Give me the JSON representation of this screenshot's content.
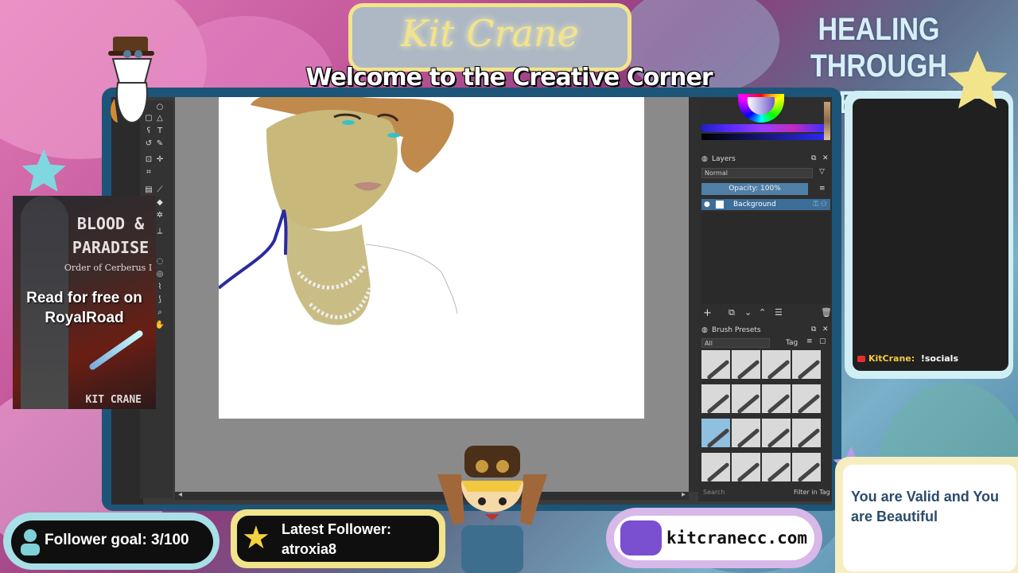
{
  "overlay": {
    "streamer_name": "Kit Crane",
    "welcome": "Welcome to the Creative Corner",
    "tagline": "HEALING THROUGH CREATIVITY"
  },
  "book": {
    "title": "BLOOD & PARADISE",
    "subtitle": "Order of Cerberus I",
    "cta": "Read for free on RoyalRoad",
    "author": "KIT CRANE"
  },
  "krita": {
    "layers_title": "Layers",
    "blend_mode": "Normal",
    "opacity_label": "Opacity:  100%",
    "layer_name": "Background",
    "brush_presets_title": "Brush Presets",
    "brush_filter": "All",
    "tag_label": "Tag",
    "search_placeholder": "Search",
    "filter_in_tag": "Filter in Tag"
  },
  "chat": {
    "username": "KitCrane:",
    "message": "!socials"
  },
  "widgets": {
    "follower_goal": "Follower goal: 3/100",
    "latest_follower_label": "Latest Follower:",
    "latest_follower_name": "atroxia8",
    "website": "kitcranecc.com",
    "affirmation": "You are Valid and You are Beautiful"
  },
  "colors": {
    "gold": "#f2e48a",
    "teal": "#a9dfe6",
    "lavender": "#d7b8e8",
    "frame_blue": "#1c5578",
    "layer_selected": "#3c6e99"
  }
}
